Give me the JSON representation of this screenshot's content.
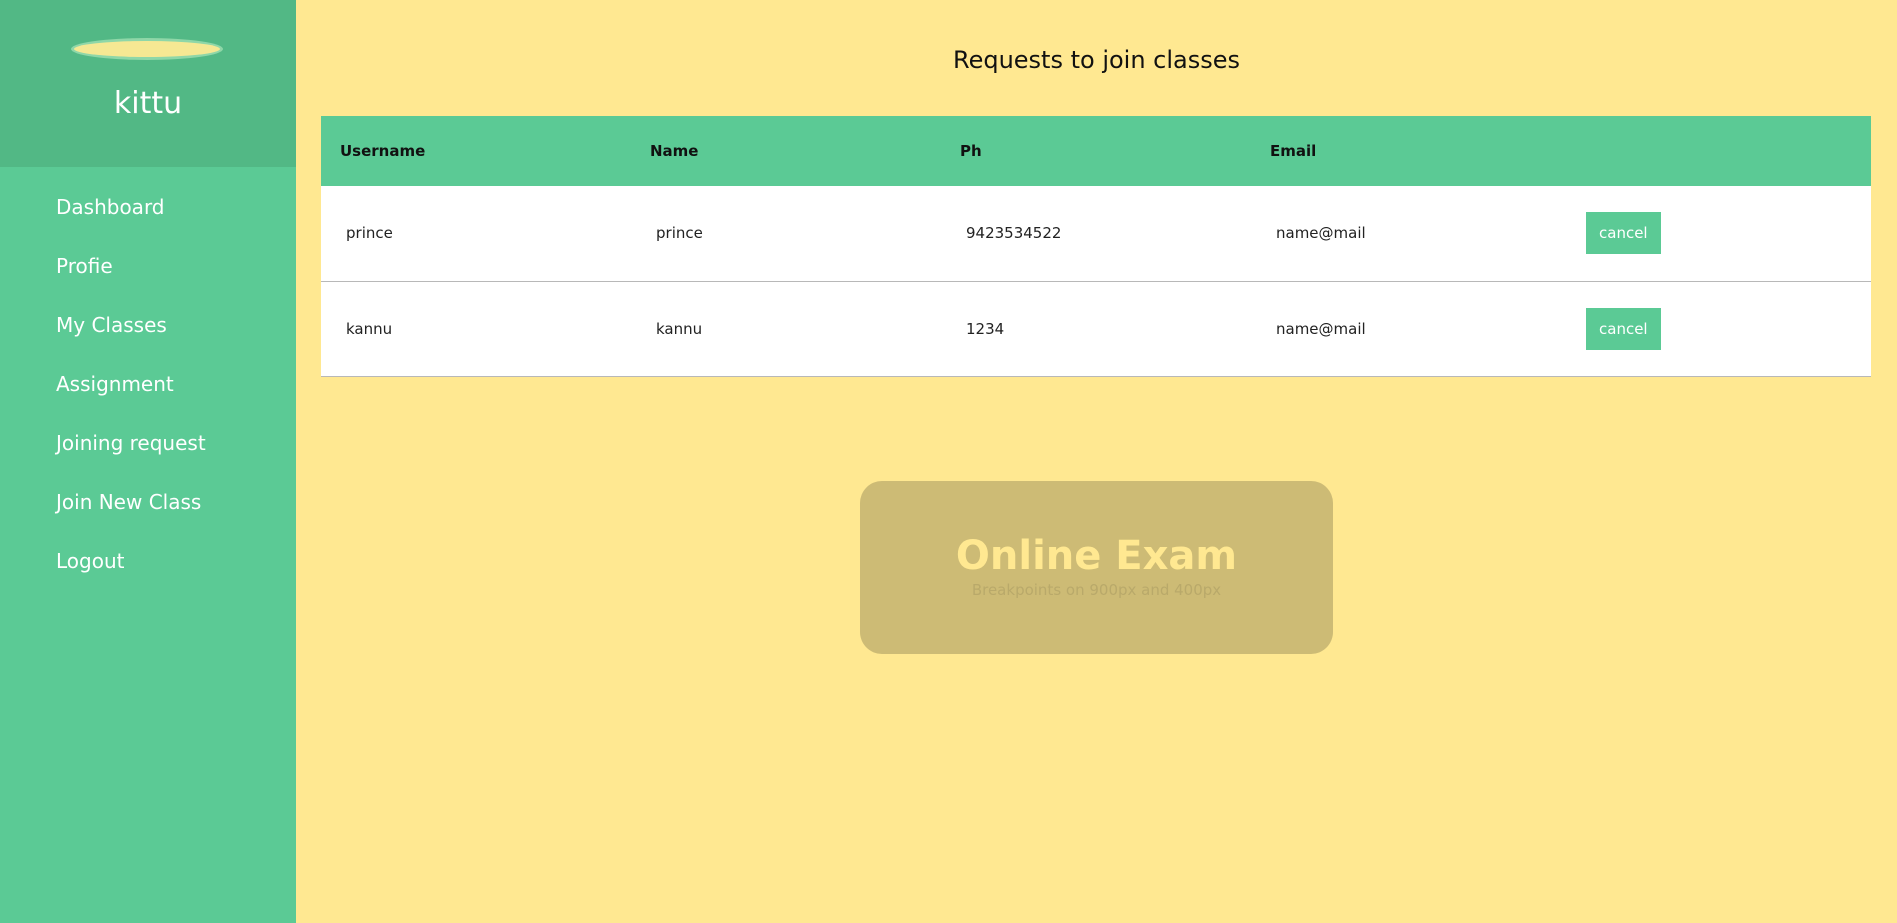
{
  "sidebar": {
    "username": "kittu",
    "items": [
      {
        "label": "Dashboard"
      },
      {
        "label": "Profie"
      },
      {
        "label": "My Classes"
      },
      {
        "label": "Assignment"
      },
      {
        "label": "Joining request"
      },
      {
        "label": "Join New Class"
      },
      {
        "label": "Logout"
      }
    ]
  },
  "main": {
    "title": "Requests to join classes",
    "table": {
      "headers": [
        "Username",
        "Name",
        "Ph",
        "Email",
        ""
      ],
      "rows": [
        {
          "username": "prince",
          "name": "prince",
          "ph": "9423534522",
          "email": "name@mail",
          "action": "cancel"
        },
        {
          "username": "kannu",
          "name": "kannu",
          "ph": "1234",
          "email": "name@mail",
          "action": "cancel"
        }
      ]
    }
  },
  "banner": {
    "title": "Online Exam",
    "subtitle": "Breakpoints on 900px and 400px"
  },
  "colors": {
    "sidebar": "#5bca95",
    "profile_bg": "#52b885",
    "page_bg": "#ffe891",
    "banner_bg": "#cdbb75"
  }
}
